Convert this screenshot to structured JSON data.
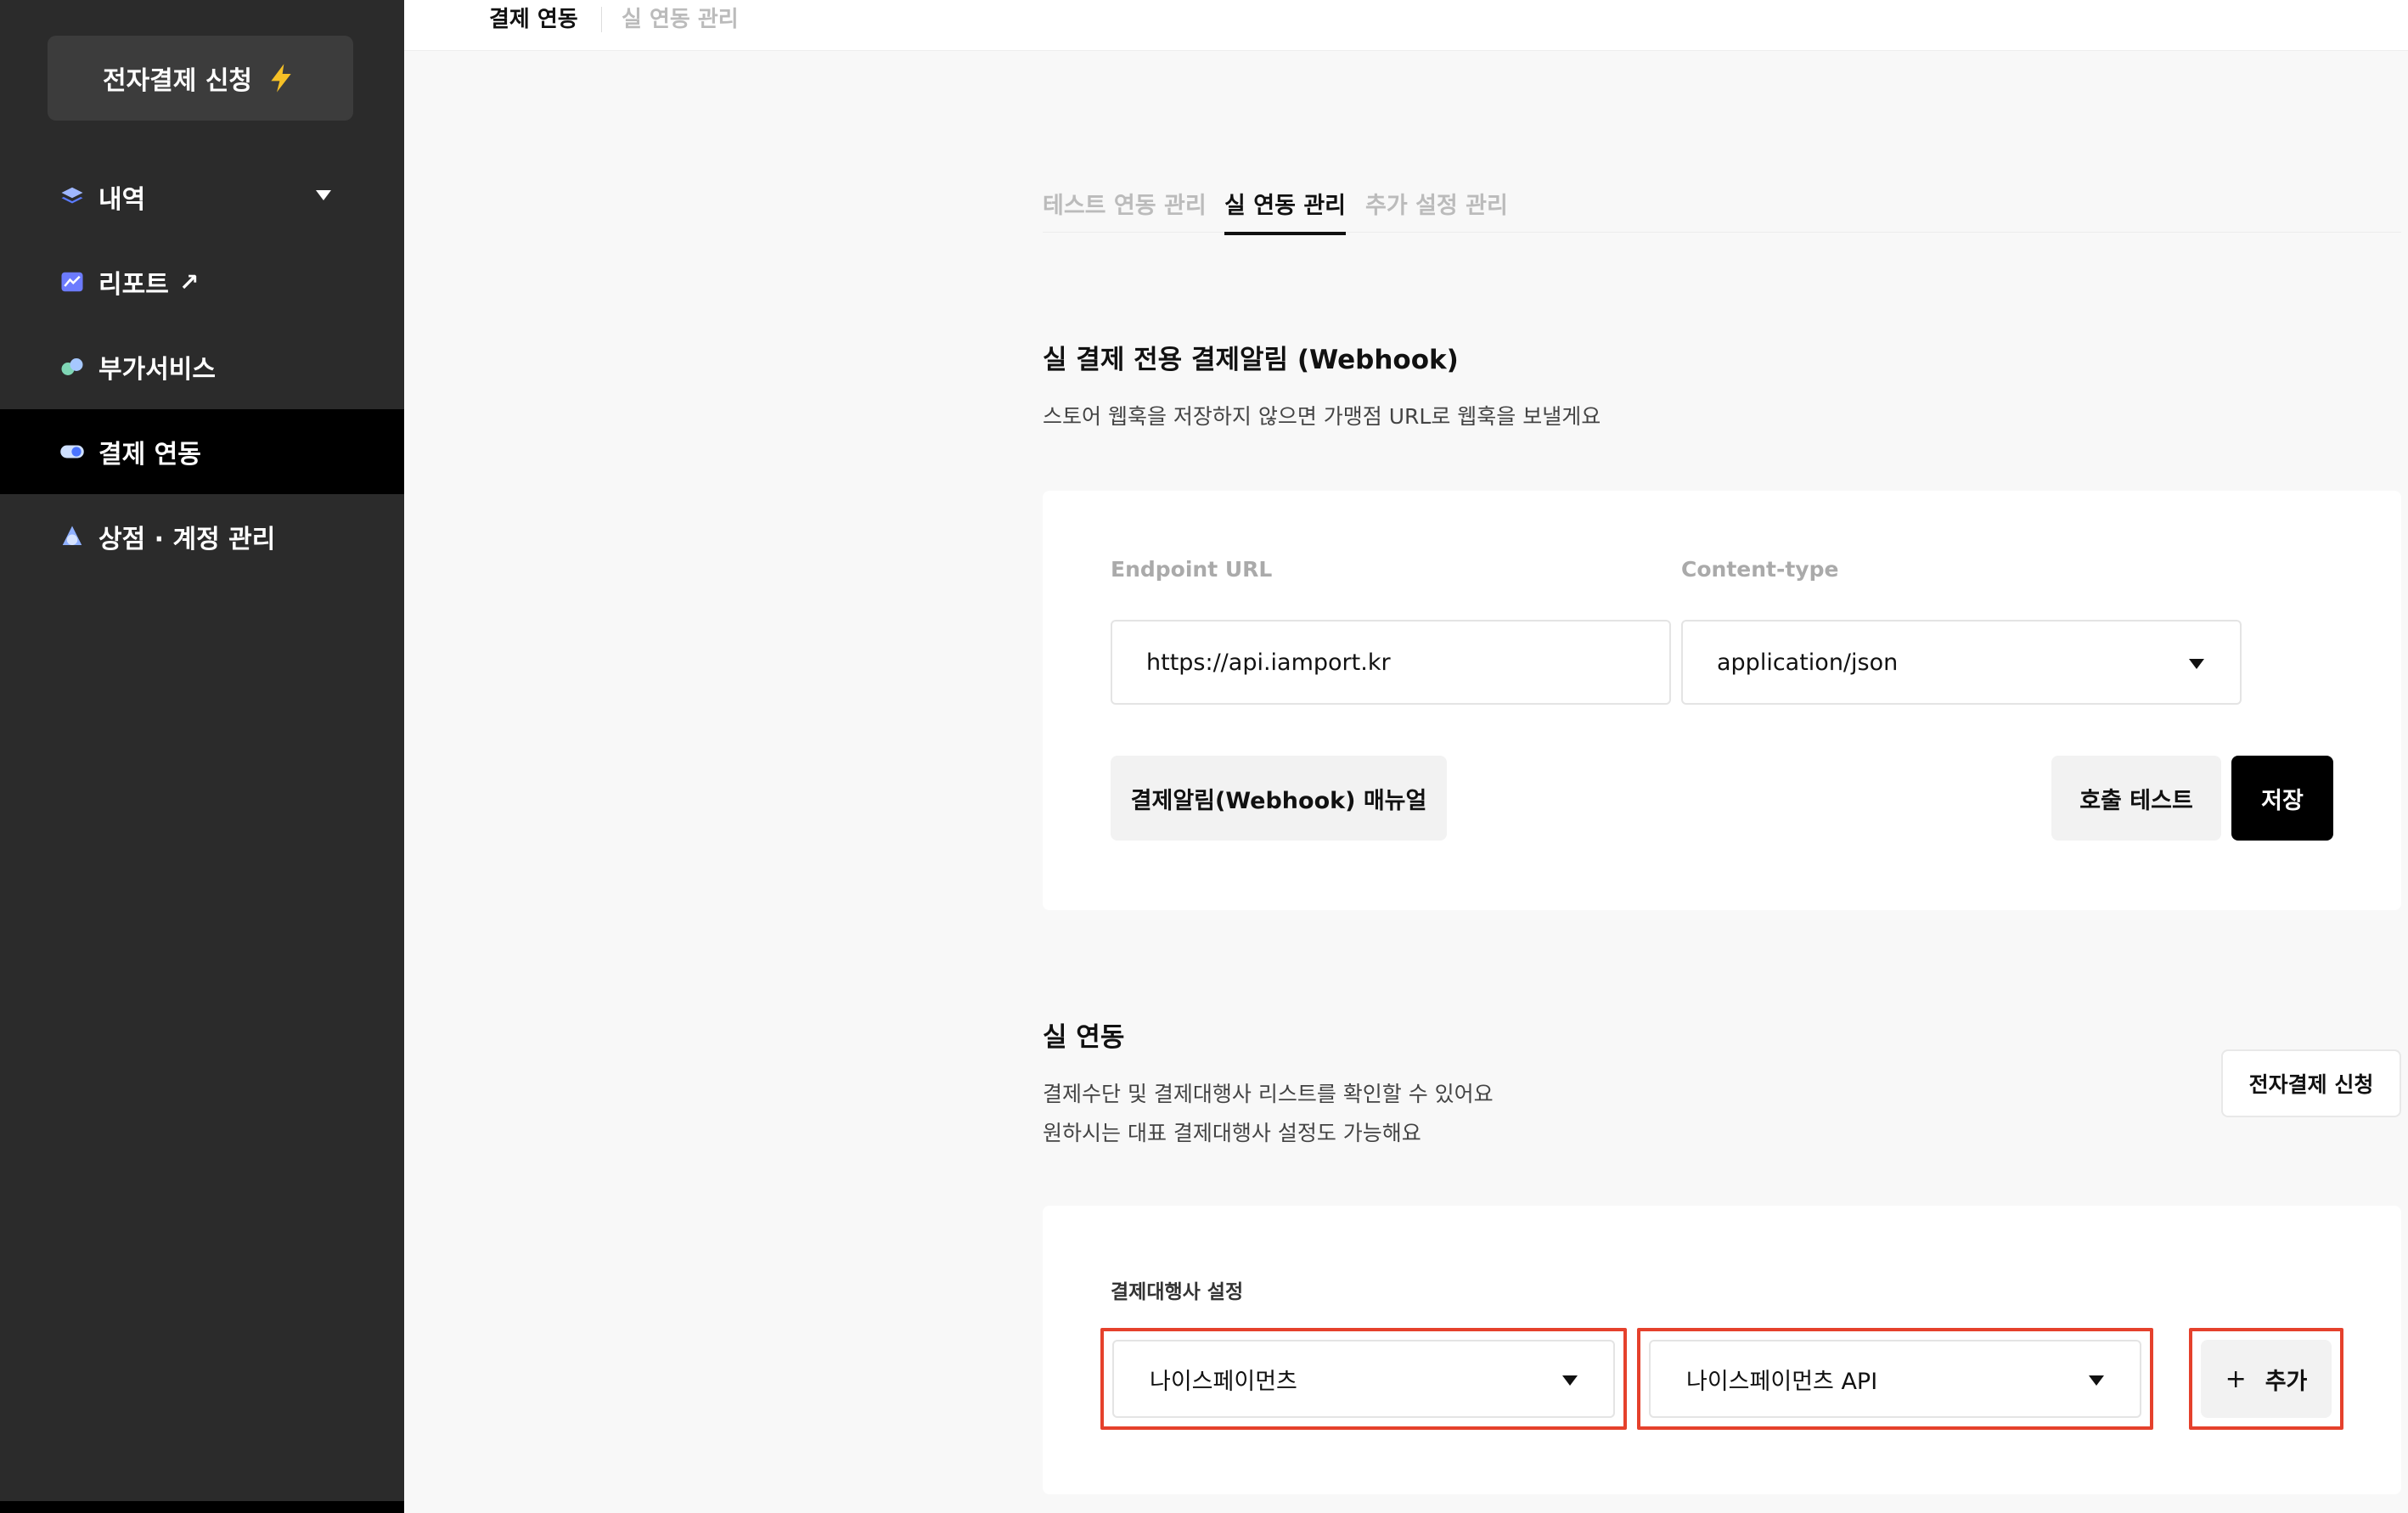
{
  "sidebar": {
    "apply_button": "전자결제 신청",
    "items": [
      {
        "label": "내역",
        "icon": "layers-icon",
        "has_caret": true
      },
      {
        "label": "리포트",
        "icon": "chart-icon",
        "external": "↗"
      },
      {
        "label": "부가서비스",
        "icon": "addon-icon"
      },
      {
        "label": "결제 연동",
        "icon": "toggle-icon",
        "active": true
      },
      {
        "label": "상점 · 계정 관리",
        "icon": "account-icon"
      }
    ]
  },
  "topbar": {
    "tabs": [
      {
        "label": "결제 연동",
        "active": true
      },
      {
        "label": "실 연동 관리",
        "active": false
      }
    ]
  },
  "subtabs": [
    {
      "label": "테스트 연동 관리",
      "active": false
    },
    {
      "label": "실 연동 관리",
      "active": true
    },
    {
      "label": "추가 설정 관리",
      "active": false
    }
  ],
  "webhook": {
    "title": "실 결제 전용 결제알림 (Webhook)",
    "desc": "스토어 웹훅을 저장하지 않으면 가맹점 URL로 웹훅을 보낼게요",
    "endpoint_label": "Endpoint URL",
    "endpoint_value": "https://api.iamport.kr",
    "content_type_label": "Content-type",
    "content_type_value": "application/json",
    "manual_button": "결제알림(Webhook) 매뉴얼",
    "test_button": "호출 테스트",
    "save_button": "저장"
  },
  "live": {
    "title": "실 연동",
    "desc_line1": "결제수단 및 결제대행사 리스트를 확인할 수 있어요",
    "desc_line2": "원하시는 대표 결제대행사 설정도 가능해요",
    "apply_button": "전자결제 신청",
    "pg_settings_label": "결제대행사 설정",
    "pg_select": "나이스페이먼츠",
    "pg_api_select": "나이스페이먼츠 API",
    "add_button": "추가",
    "add_icon": "+"
  },
  "colors": {
    "sidebar_bg": "#2b2b2b",
    "active_bg": "#000000",
    "highlight": "#e5412c",
    "bolt": "#f5c026"
  }
}
